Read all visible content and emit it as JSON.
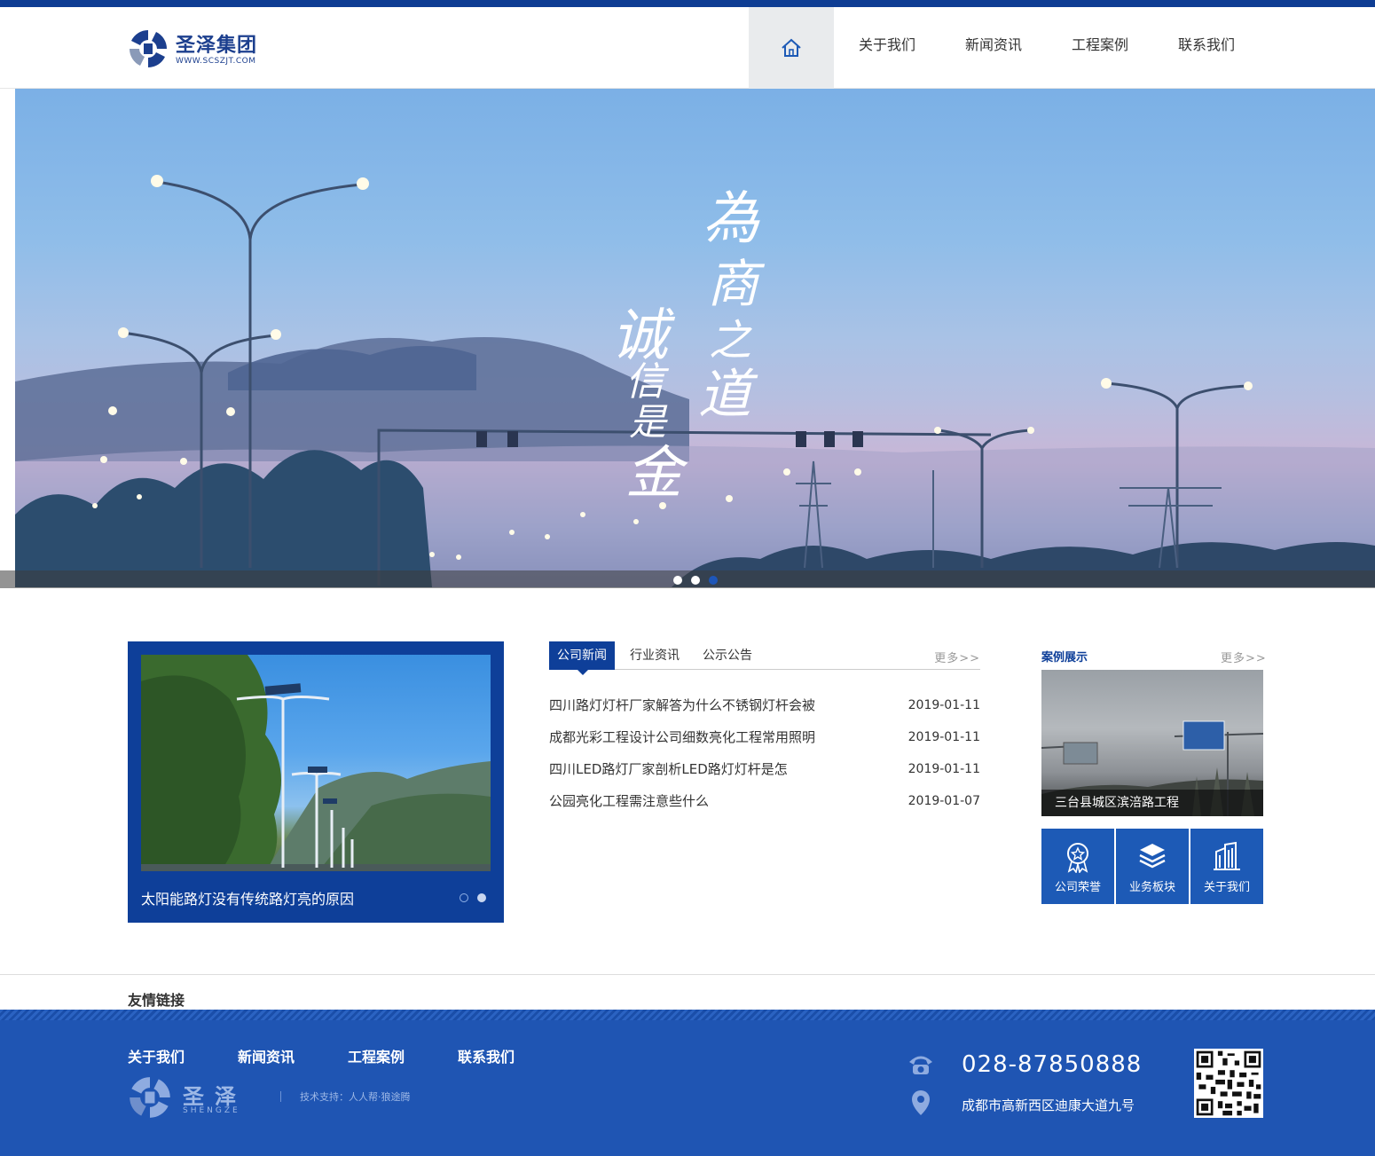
{
  "header": {
    "logo_title": "圣泽集团",
    "logo_url": "WWW.SCSZJT.COM",
    "nav": [
      {
        "label": "关于我们"
      },
      {
        "label": "新闻资讯"
      },
      {
        "label": "工程案例"
      },
      {
        "label": "联系我们"
      }
    ],
    "home_icon": "home-icon"
  },
  "banner": {
    "calligraphy_right": "為商之道",
    "calligraphy_left": "诚信是金",
    "slide_count": 3,
    "active_slide": 3
  },
  "feature": {
    "caption": "太阳能路灯没有传统路灯亮的原因",
    "slide_count": 2,
    "active_slide": 2
  },
  "news": {
    "tabs": [
      {
        "label": "公司新闻",
        "active": true
      },
      {
        "label": "行业资讯",
        "active": false
      },
      {
        "label": "公示公告",
        "active": false
      }
    ],
    "more": "更多>>",
    "items": [
      {
        "title": "四川路灯灯杆厂家解答为什么不锈钢灯杆会被",
        "date": "2019-01-11"
      },
      {
        "title": "成都光彩工程设计公司细数亮化工程常用照明",
        "date": "2019-01-11"
      },
      {
        "title": "四川LED路灯厂家剖析LED路灯灯杆是怎",
        "date": "2019-01-11"
      },
      {
        "title": "公园亮化工程需注意些什么",
        "date": "2019-01-07"
      }
    ]
  },
  "cases": {
    "heading": "案例展示",
    "more": "更多>>",
    "caption": "三台县城区滨涪路工程",
    "buttons": [
      {
        "label": "公司荣誉",
        "icon": "award-icon"
      },
      {
        "label": "业务板块",
        "icon": "layers-icon"
      },
      {
        "label": "关于我们",
        "icon": "building-icon"
      }
    ]
  },
  "friend_links": {
    "heading": "友情链接"
  },
  "footer": {
    "nav": [
      {
        "label": "关于我们"
      },
      {
        "label": "新闻资讯"
      },
      {
        "label": "工程案例"
      },
      {
        "label": "联系我们"
      }
    ],
    "logo_text": "圣泽",
    "logo_sub": "SHENGZE",
    "support": "技术支持：人人帮·狼途腾",
    "phone": "028-87850888",
    "address": "成都市高新西区迪康大道九号",
    "qr_icon": "qr-code-icon"
  },
  "colors": {
    "brand": "#0e3f99",
    "footer": "#1f55b3",
    "button": "#1d5ab6"
  }
}
